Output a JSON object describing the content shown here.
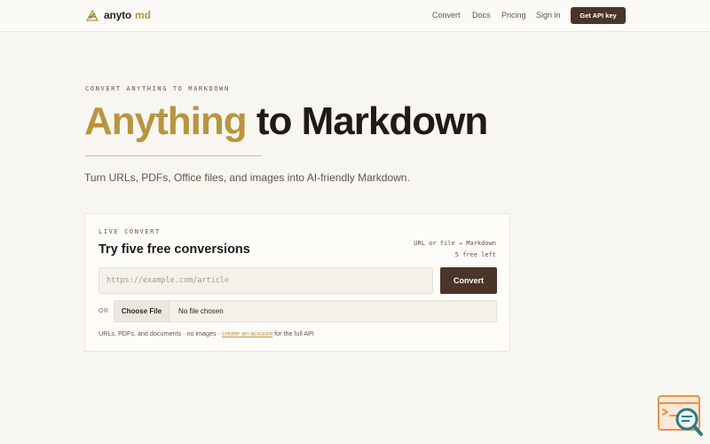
{
  "header": {
    "logo_text": "anyto",
    "logo_accent": "md",
    "nav": [
      "Convert",
      "Docs",
      "Pricing",
      "Sign in"
    ],
    "cta_label": "Get API key"
  },
  "hero": {
    "eyebrow": "CONVERT ANYTHING TO MARKDOWN",
    "headline_accent": "Anything",
    "headline_rest": "to Markdown",
    "subtitle": "Turn URLs, PDFs, Office files, and images into AI-friendly Markdown."
  },
  "card": {
    "eyebrow": "LIVE CONVERT",
    "title": "Try five free conversions",
    "meta_line1": "URL or file → Markdown",
    "meta_line2": "5 free left",
    "url_placeholder": "https://example.com/article",
    "url_value": "",
    "convert_label": "Convert",
    "or_label": "OR",
    "choose_file_label": "Choose File",
    "file_status": "No file chosen",
    "footnote_pre": "URLs, PDFs, and documents · no images · ",
    "footnote_link": "create an account",
    "footnote_post": " for the full API"
  },
  "colors": {
    "accent": "#b8953f",
    "brand_dark": "#4a3528",
    "background": "#f8f6f1",
    "widget_orange": "#e8924a",
    "widget_teal": "#2a7a8a"
  },
  "icons": {
    "logo": "logo-mark-icon",
    "widget": "search-chat-widget-icon"
  }
}
